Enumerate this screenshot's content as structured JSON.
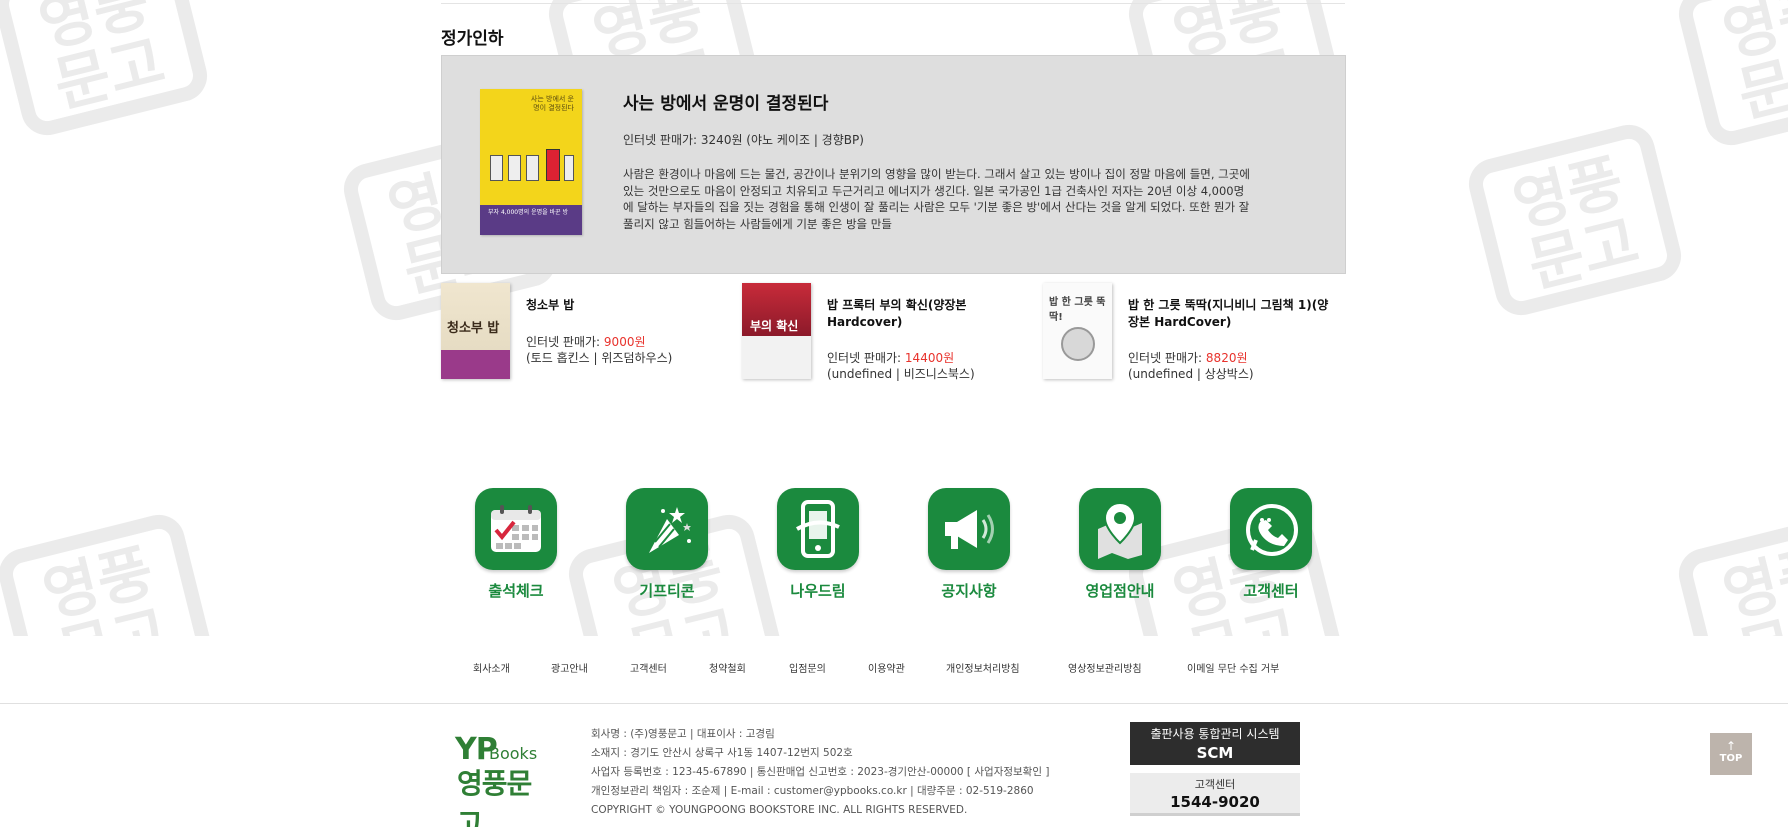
{
  "section": {
    "title": "정가인하"
  },
  "featured": {
    "cover_text": "사는 방에서 운명이 결정된다",
    "cover_band": "부자 4,000명의 운명을 바꾼 방",
    "title": "사는 방에서 운명이 결정된다",
    "price_line": "인터넷 판매가: 3240원 (야노 케이조 | 경향BP)",
    "description": "사람은 환경이나 마음에 드는 물건, 공간이나 분위기의 영향을 많이 받는다. 그래서 살고 있는 방이나 집이 정말 마음에 들면, 그곳에 있는 것만으로도 마음이 안정되고 치유되고 두근거리고 에너지가 생긴다. 일본 국가공인 1급 건축사인 저자는 20년 이상 4,000명에 달하는 부자들의 집을 짓는 경험을 통해 인생이 잘 풀리는 사람은 모두 '기분 좋은 방'에서 산다는 것을 알게 되었다. 또한 뭔가 잘 풀리지 않고 힘들어하는 사람들에게 기분 좋은 방을 만들"
  },
  "books": [
    {
      "title": "청소부 밥",
      "price_label": "인터넷 판매가: ",
      "price": "9000원",
      "publisher": "(토드 홉킨스 | 위즈덤하우스)",
      "cover_text": "청소부 밥"
    },
    {
      "title": "밥 프록터 부의 확신(양장본 Hardcover)",
      "price_label": "인터넷 판매가: ",
      "price": "14400원",
      "publisher": "(undefined | 비즈니스북스)",
      "cover_text": "부의 확신"
    },
    {
      "title": "밥 한 그릇 뚝딱(지니비니 그림책 1)(양장본 HardCover)",
      "price_label": "인터넷 판매가: ",
      "price": "8820원",
      "publisher": "(undefined | 상상박스)",
      "cover_text": "밥 한 그릇 뚝딱!"
    }
  ],
  "services": [
    {
      "label": "출석체크",
      "icon": "calendar-icon"
    },
    {
      "label": "기프티콘",
      "icon": "party-icon"
    },
    {
      "label": "나우드림",
      "icon": "mobile-icon"
    },
    {
      "label": "공지사항",
      "icon": "megaphone-icon"
    },
    {
      "label": "영업점안내",
      "icon": "map-pin-icon"
    },
    {
      "label": "고객센터",
      "icon": "phone-chat-icon"
    }
  ],
  "footer_links": [
    "회사소개",
    "광고안내",
    "고객센터",
    "청약철회",
    "입점문의",
    "이용약관",
    "개인정보처리방침",
    "영상정보관리방침",
    "이메일 무단 수집 거부"
  ],
  "logo": {
    "yp": "YP",
    "books": "Books",
    "korean": "영풍문고"
  },
  "company_info": [
    "회사명 : (주)영풍문고  | 대표이사 : 고경림",
    "소재지 : 경기도 안산시 상록구 사1동 1407-12번지 502호",
    "사업자 등록번호 : 123-45-67890  |  통신판매업 신고번호 : 2023-경기안산-00000 [ 사업자정보확인 ]",
    "개인정보관리 책임자 : 조순제  |  E-mail : customer@ypbooks.co.kr  |  대량주문 : 02-519-2860",
    "COPYRIGHT © YOUNGPOONG BOOKSTORE INC. ALL RIGHTS RESERVED."
  ],
  "scm": {
    "sub": "출판사용 통합관리 시스템",
    "main": "SCM"
  },
  "customer_center": {
    "sub": "고객센터",
    "phone": "1544-9020"
  },
  "top_button": {
    "arrow": "↑",
    "label": "TOP"
  },
  "watermark": {
    "text_top": "영풍",
    "text_bottom": "문고"
  },
  "colors": {
    "accent_green": "#1b8a3e",
    "price_red": "#e8322c",
    "feature_bg": "#dedede"
  }
}
